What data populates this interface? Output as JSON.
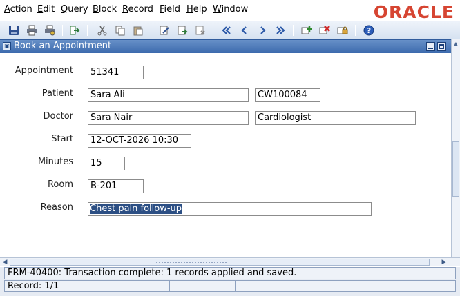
{
  "menu": [
    {
      "accel": "A",
      "rest": "ction"
    },
    {
      "accel": "E",
      "rest": "dit"
    },
    {
      "accel": "Q",
      "rest": "uery"
    },
    {
      "accel": "B",
      "rest": "lock"
    },
    {
      "accel": "R",
      "rest": "ecord"
    },
    {
      "accel": "F",
      "rest": "ield"
    },
    {
      "accel": "H",
      "rest": "elp"
    },
    {
      "accel": "W",
      "rest": "indow"
    }
  ],
  "brand": {
    "logo_text": "ORACLE",
    "color": "#d64532"
  },
  "toolbar": {
    "icons": [
      "save-icon",
      "print-icon",
      "print-setup-icon",
      "exit-icon",
      "cut-icon",
      "copy-icon",
      "paste-icon",
      "edit-icon",
      "query-enter-icon",
      "query-execute-icon",
      "first-record-icon",
      "previous-record-icon",
      "next-record-icon",
      "last-record-icon",
      "insert-record-icon",
      "delete-record-icon",
      "lock-record-icon",
      "help-icon"
    ]
  },
  "window": {
    "title": "Book an Appointment"
  },
  "form": {
    "labels": {
      "appointment": "Appointment",
      "patient": "Patient",
      "doctor": "Doctor",
      "start": "Start",
      "minutes": "Minutes",
      "room": "Room",
      "reason": "Reason"
    },
    "values": {
      "appointment": "51341",
      "patient_name": "Sara Ali",
      "patient_id": "CW100084",
      "doctor_name": "Sara Nair",
      "doctor_specialty": "Cardiologist",
      "start": "12-OCT-2026 10:30",
      "minutes": "15",
      "room": "B-201",
      "reason": "Chest pain follow-up"
    }
  },
  "status": {
    "message": "FRM-40400: Transaction complete: 1 records applied and saved.",
    "record": "Record: 1/1"
  },
  "colors": {
    "window_title_bar": "#3c6aad",
    "selection": "#2c4f84"
  }
}
